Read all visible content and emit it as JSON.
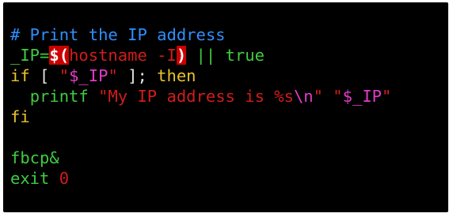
{
  "colors": {
    "background": "#000000",
    "comment": "#2f8fff",
    "default": "#e6e6e6",
    "keyword": "#e8c22a",
    "command": "#3fcc3f",
    "string": "#d21c1c",
    "variable": "#e23cc9",
    "highlight_bg": "#cc0000"
  },
  "lines": [
    {
      "tokens": [
        {
          "text": "# Print the IP address",
          "color": "#2f8fff"
        }
      ]
    },
    {
      "tokens": [
        {
          "text": "_IP=",
          "color": "#3fcc3f"
        },
        {
          "text": "$(",
          "color": "#ffffff",
          "highlight": true
        },
        {
          "text": "hostname -I",
          "color": "#d21c1c"
        },
        {
          "text": ")",
          "color": "#ffffff",
          "highlight": true
        },
        {
          "text": " || ",
          "color": "#3fcc3f"
        },
        {
          "text": "true",
          "color": "#3fcc3f"
        }
      ]
    },
    {
      "tokens": [
        {
          "text": "if",
          "color": "#e8c22a"
        },
        {
          "text": " [ ",
          "color": "#e6e6e6"
        },
        {
          "text": "\"",
          "color": "#d21c1c"
        },
        {
          "text": "$_IP",
          "color": "#e23cc9"
        },
        {
          "text": "\"",
          "color": "#d21c1c"
        },
        {
          "text": " ]; ",
          "color": "#e6e6e6"
        },
        {
          "text": "then",
          "color": "#e8c22a"
        }
      ]
    },
    {
      "tokens": [
        {
          "text": "  ",
          "color": "#e6e6e6"
        },
        {
          "text": "printf",
          "color": "#3fcc3f"
        },
        {
          "text": " \"My IP address is %s",
          "color": "#d21c1c"
        },
        {
          "text": "\\n",
          "color": "#e23cc9"
        },
        {
          "text": "\" \"",
          "color": "#d21c1c"
        },
        {
          "text": "$_IP",
          "color": "#e23cc9"
        },
        {
          "text": "\"",
          "color": "#d21c1c"
        }
      ]
    },
    {
      "tokens": [
        {
          "text": "fi",
          "color": "#e8c22a"
        }
      ]
    },
    {
      "tokens": [
        {
          "text": "",
          "color": "#e6e6e6"
        }
      ]
    },
    {
      "tokens": [
        {
          "text": "fbcp&",
          "color": "#3fcc3f"
        }
      ]
    },
    {
      "tokens": [
        {
          "text": "exit",
          "color": "#3fcc3f"
        },
        {
          "text": " ",
          "color": "#e6e6e6"
        },
        {
          "text": "0",
          "color": "#d21c1c"
        }
      ]
    }
  ]
}
